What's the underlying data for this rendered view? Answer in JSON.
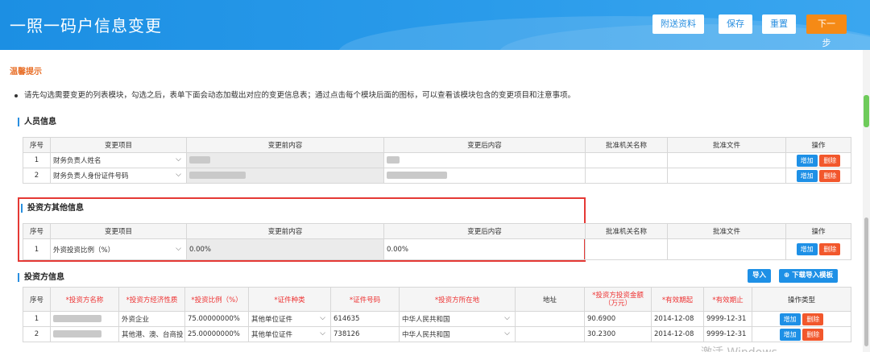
{
  "header": {
    "title": "一照一码户信息变更",
    "buttons": {
      "attach": "附送资料",
      "save": "保存",
      "reset": "重置",
      "next": "下一步"
    }
  },
  "tip": {
    "title": "温馨提示",
    "text": "请先勾选需要变更的列表模块，勾选之后，表单下面会动态加载出对应的变更信息表；通过点击每个模块后面的图标，可以查看该模块包含的变更项目和注意事项。"
  },
  "personnel": {
    "title": "人员信息",
    "headers": [
      "序号",
      "变更项目",
      "变更前内容",
      "变更后内容",
      "批准机关名称",
      "批准文件",
      "操作"
    ],
    "rows": [
      {
        "no": "1",
        "item": "财务负责人姓名"
      },
      {
        "no": "2",
        "item": "财务负责人身份证件号码"
      }
    ],
    "add_label": "增加",
    "delete_label": "删除"
  },
  "investor_other": {
    "title": "投资方其他信息",
    "headers": [
      "序号",
      "变更项目",
      "变更前内容",
      "变更后内容",
      "批准机关名称",
      "批准文件",
      "操作"
    ],
    "rows": [
      {
        "no": "1",
        "item": "外资投资比例（%）",
        "before": "0.00%",
        "after": "0.00%"
      }
    ],
    "add_label": "增加",
    "delete_label": "删除"
  },
  "investor": {
    "title": "投资方信息",
    "import_label": "导入",
    "download_label": "下载导入模板",
    "headers": [
      "序号",
      "*投资方名称",
      "*投资方经济性质",
      "*投资比例（%）",
      "*证件种类",
      "*证件号码",
      "*投资方所在地",
      "地址",
      "*投资方投资金额（万元）",
      "*有效期起",
      "*有效期止",
      "操作类型"
    ],
    "rows": [
      {
        "no": "1",
        "nature": "外资企业",
        "ratio": "75.00000000%",
        "id_type": "其他单位证件",
        "id_no": "614635",
        "location": "中华人民共和国",
        "address": "",
        "amount": "90.6900",
        "start": "2014-12-08",
        "end": "9999-12-31"
      },
      {
        "no": "2",
        "nature": "其他港、澳、台商投",
        "ratio": "25.00000000%",
        "id_type": "其他单位证件",
        "id_no": "738126",
        "location": "中华人民共和国",
        "address": "",
        "amount": "30.2300",
        "start": "2014-12-08",
        "end": "9999-12-31"
      }
    ],
    "add_label": "增加",
    "delete_label": "删除"
  },
  "watermark": "激活 Windows",
  "colors": {
    "header_blue": "#2a9bea",
    "accent_orange": "#f58a16",
    "button_blue": "#1e90e6",
    "button_red": "#f2572c",
    "highlight_red": "#e53935"
  }
}
